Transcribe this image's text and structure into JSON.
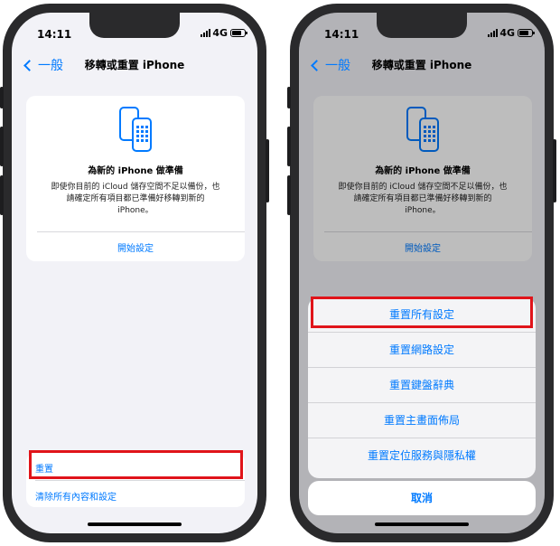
{
  "status": {
    "time": "14:11",
    "network": "4G"
  },
  "nav": {
    "back_label": "一般",
    "title": "移轉或重置 iPhone"
  },
  "prepare_card": {
    "title": "為新的 iPhone 做準備",
    "description_lines": [
      "即使你目前的 iCloud 儲存空間不足以備份，也",
      "請確定所有項目都已準備好移轉到新的",
      "iPhone。"
    ],
    "action_label": "開始設定",
    "icon": "phone-transfer-icon"
  },
  "options": {
    "reset_label": "重置",
    "erase_label": "清除所有內容和設定"
  },
  "reset_sheet": {
    "items": [
      "重置所有設定",
      "重置網路設定",
      "重置鍵盤辭典",
      "重置主畫面佈局",
      "重置定位服務與隱私權"
    ],
    "cancel_label": "取消"
  },
  "colors": {
    "accent": "#007aff",
    "highlight": "#e0141a",
    "background": "#f2f2f7"
  }
}
